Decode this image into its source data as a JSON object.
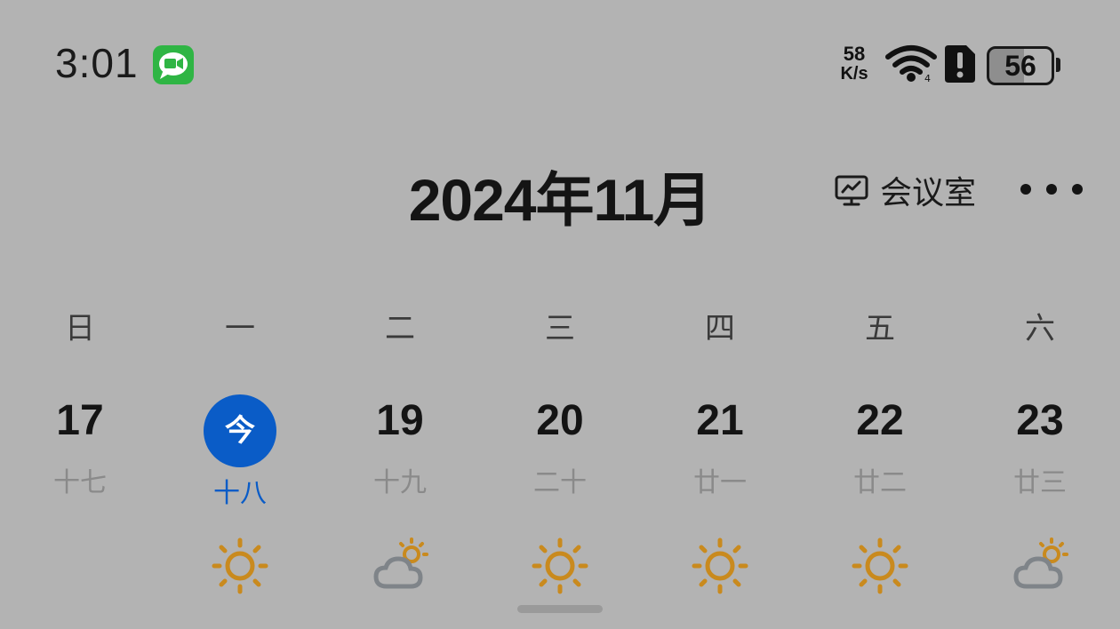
{
  "status_bar": {
    "time": "3:01",
    "net_speed_value": "58",
    "net_speed_unit": "K/s",
    "battery_level": "56",
    "icons": [
      "message-app-icon",
      "wifi-icon",
      "sim-alert-icon",
      "battery-icon"
    ]
  },
  "header": {
    "title": "2024年11月",
    "meeting_label": "会议室",
    "more_icon": "more-dots-icon"
  },
  "calendar": {
    "weekdays": [
      "日",
      "一",
      "二",
      "三",
      "四",
      "五",
      "六"
    ],
    "days": [
      {
        "day": "17",
        "lunar": "十七",
        "weather": ""
      },
      {
        "day": "今",
        "lunar": "十八",
        "weather": "sunny",
        "today": true
      },
      {
        "day": "19",
        "lunar": "十九",
        "weather": "partly-cloudy"
      },
      {
        "day": "20",
        "lunar": "二十",
        "weather": "sunny"
      },
      {
        "day": "21",
        "lunar": "廿一",
        "weather": "sunny"
      },
      {
        "day": "22",
        "lunar": "廿二",
        "weather": "sunny"
      },
      {
        "day": "23",
        "lunar": "廿三",
        "weather": "partly-cloudy"
      }
    ]
  },
  "colors": {
    "background": "#b3b3b3",
    "today_accent": "#0a5cc7",
    "sun": "#c98a1e",
    "cloud": "#7f8489"
  }
}
